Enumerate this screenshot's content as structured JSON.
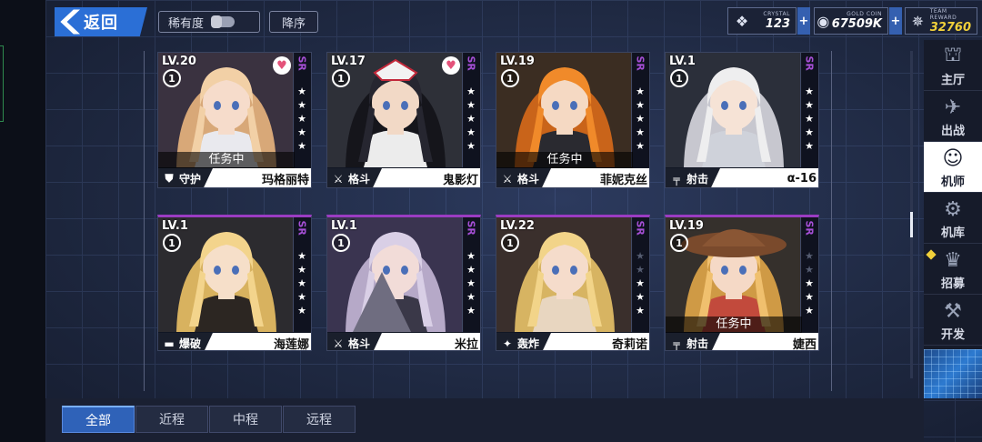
{
  "topbar": {
    "back_label": "返回",
    "rarity_filter_label": "稀有度",
    "sort_label": "降序"
  },
  "resources": [
    {
      "caption": "CRYSTAL",
      "value": "123",
      "icon": "crystal-icon"
    },
    {
      "caption": "GOLD COIN",
      "value": "67509K",
      "icon": "gold-coin-icon"
    },
    {
      "caption": "TEAM REWARD",
      "value": "32760",
      "icon": "team-reward-icon"
    }
  ],
  "cards": [
    {
      "level": "LV.20",
      "rank": "1",
      "rarity": "SR",
      "stars": 5,
      "favorite": true,
      "status": "任务中",
      "class_label": "守护",
      "class_icon": "shield-icon",
      "name": "玛格丽特"
    },
    {
      "level": "LV.17",
      "rank": "1",
      "rarity": "SR",
      "stars": 5,
      "favorite": true,
      "status": "",
      "class_label": "格斗",
      "class_icon": "crossed-swords-icon",
      "name": "鬼影灯"
    },
    {
      "level": "LV.19",
      "rank": "1",
      "rarity": "SR",
      "stars": 5,
      "favorite": false,
      "status": "任务中",
      "class_label": "格斗",
      "class_icon": "crossed-swords-icon",
      "name": "菲妮克丝"
    },
    {
      "level": "LV.1",
      "rank": "1",
      "rarity": "SR",
      "stars": 5,
      "favorite": false,
      "status": "",
      "class_label": "射击",
      "class_icon": "rifle-icon",
      "name": "α-16"
    },
    {
      "level": "LV.1",
      "rank": "1",
      "rarity": "SR",
      "stars": 5,
      "favorite": false,
      "status": "",
      "class_label": "爆破",
      "class_icon": "launcher-icon",
      "name": "海莲娜"
    },
    {
      "level": "LV.1",
      "rank": "1",
      "rarity": "SR",
      "stars": 5,
      "favorite": false,
      "status": "",
      "class_label": "格斗",
      "class_icon": "crossed-swords-icon",
      "name": "米拉"
    },
    {
      "level": "LV.22",
      "rank": "1",
      "rarity": "SR",
      "stars": 3,
      "favorite": false,
      "status": "",
      "class_label": "轰炸",
      "class_icon": "bomb-icon",
      "name": "奇莉诺"
    },
    {
      "level": "LV.19",
      "rank": "1",
      "rarity": "SR",
      "stars": 3,
      "favorite": false,
      "status": "任务中",
      "class_label": "射击",
      "class_icon": "rifle-icon",
      "name": "婕西"
    }
  ],
  "nav": [
    {
      "label": "主厅",
      "icon": "hall-icon"
    },
    {
      "label": "出战",
      "icon": "battle-icon"
    },
    {
      "label": "机师",
      "icon": "pilot-icon",
      "active": true
    },
    {
      "label": "机库",
      "icon": "hangar-icon"
    },
    {
      "label": "招募",
      "icon": "recruit-icon"
    },
    {
      "label": "开发",
      "icon": "develop-icon"
    }
  ],
  "tabs": [
    {
      "label": "全部",
      "active": true
    },
    {
      "label": "近程"
    },
    {
      "label": "中程"
    },
    {
      "label": "远程"
    }
  ],
  "colors": {
    "accent_blue": "#2b6fd6",
    "rarity_purple": "#a64fd6",
    "favorite_pink": "#e4527a",
    "reward_gold": "#f1d03a"
  }
}
